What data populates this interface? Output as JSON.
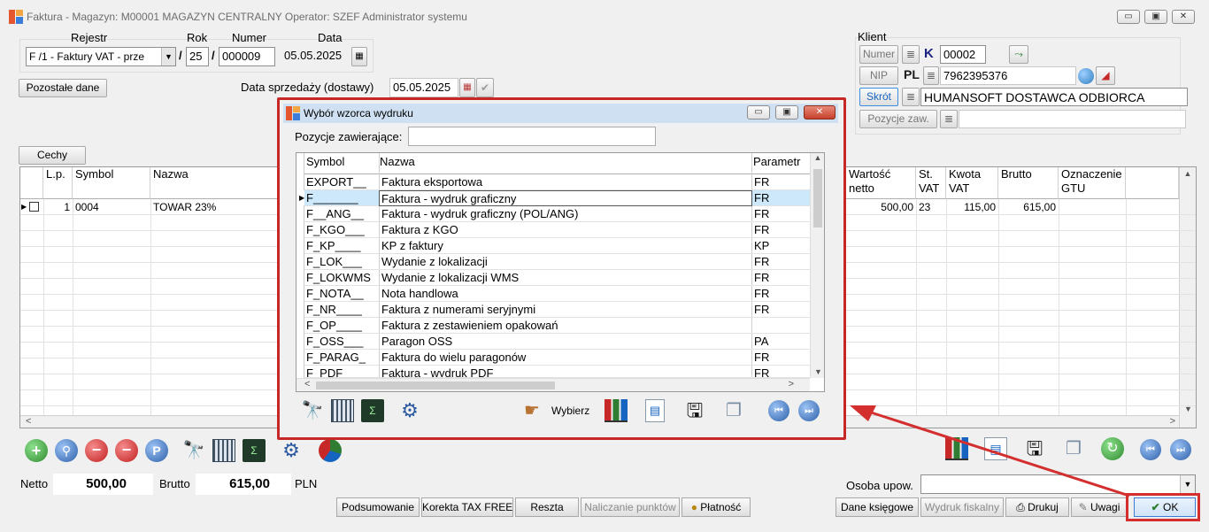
{
  "window": {
    "title": "Faktura - Magazyn: M00001 MAGAZYN CENTRALNY  Operator: SZEF Administrator systemu",
    "min_glyph": "▭",
    "max_glyph": "▣",
    "close_glyph": "✕"
  },
  "header": {
    "rejestr_label": "Rejestr",
    "rejestr_value": "F /1   - Faktury VAT - prze",
    "rok_label": "Rok",
    "rok_value": "25",
    "numer_label": "Numer",
    "numer_value": "000009",
    "data_label": "Data",
    "data_value": "05.05.2025",
    "slash": "/",
    "pozostale_button": "Pozostałe dane",
    "data_sprzedazy_label": "Data sprzedaży (dostawy)",
    "data_sprzedazy_value": "05.05.2025",
    "cechy_button": "Cechy"
  },
  "client": {
    "section_label": "Klient",
    "numer_button": "Numer",
    "k_badge": "K",
    "numer_value": "00002",
    "nip_button": "NIP",
    "pl_badge": "PL",
    "nip_value": "7962395376",
    "skrot_button": "Skrót",
    "skrot_value": "HUMANSOFT DOSTAWCA ODBIORCA",
    "pozycje_button": "Pozycje zaw.",
    "pozycje_value": ""
  },
  "grid": {
    "columns": [
      {
        "label": "L.p."
      },
      {
        "label": "Symbol"
      },
      {
        "label": "Nazwa"
      },
      {
        "label": "Wartość netto"
      },
      {
        "label": "St. VAT"
      },
      {
        "label": "Kwota VAT"
      },
      {
        "label": "Brutto"
      },
      {
        "label": "Oznaczenie GTU"
      }
    ],
    "rows": [
      {
        "lp": "1",
        "symbol": "0004",
        "nazwa": "TOWAR 23%",
        "netto": "500,00",
        "vat": "23",
        "kwota_vat": "115,00",
        "brutto": "615,00",
        "gtu": ""
      }
    ]
  },
  "dialog": {
    "title": "Wybór wzorca wydruku",
    "filter_label": "Pozycje zawierające:",
    "filter_value": "",
    "columns": {
      "symbol": "Symbol",
      "nazwa": "Nazwa",
      "param": "Parametr"
    },
    "rows": [
      {
        "symbol": "EXPORT__",
        "nazwa": "Faktura eksportowa",
        "param": "FR"
      },
      {
        "symbol": "F_______",
        "nazwa": "Faktura - wydruk graficzny",
        "param": "FR"
      },
      {
        "symbol": "F__ANG__",
        "nazwa": "Faktura - wydruk graficzny (POL/ANG)",
        "param": "FR"
      },
      {
        "symbol": "F_KGO___",
        "nazwa": "Faktura z KGO",
        "param": "FR"
      },
      {
        "symbol": "F_KP____",
        "nazwa": "KP z faktury",
        "param": "KP"
      },
      {
        "symbol": "F_LOK___",
        "nazwa": "Wydanie z lokalizacji",
        "param": "FR"
      },
      {
        "symbol": "F_LOKWMS",
        "nazwa": "Wydanie z lokalizacji WMS",
        "param": "FR"
      },
      {
        "symbol": "F_NOTA__",
        "nazwa": "Nota handlowa",
        "param": "FR"
      },
      {
        "symbol": "F_NR____",
        "nazwa": "Faktura z numerami seryjnymi",
        "param": "FR"
      },
      {
        "symbol": "F_OP____",
        "nazwa": "Faktura z zestawieniem opakowań",
        "param": ""
      },
      {
        "symbol": "F_OSS___",
        "nazwa": "Paragon OSS",
        "param": "PA"
      },
      {
        "symbol": "F_PARAG_",
        "nazwa": "Faktura do wielu paragonów",
        "param": "FR"
      },
      {
        "symbol": "F_PDF___",
        "nazwa": "Faktura - wydruk PDF",
        "param": "FR"
      }
    ],
    "wybierz_button": "Wybierz"
  },
  "totals": {
    "netto_label": "Netto",
    "netto_value": "500,00",
    "brutto_label": "Brutto",
    "brutto_value": "615,00",
    "currency": "PLN",
    "osoba_label": "Osoba upow."
  },
  "footer": {
    "podsumowanie": "Podsumowanie",
    "korekta": "Korekta TAX FREE",
    "reszta": "Reszta",
    "naliczanie": "Naliczanie punktów",
    "platnosc": "Płatność",
    "dane_ksiegowe": "Dane księgowe",
    "wydruk_fiskalny": "Wydruk fiskalny",
    "drukuj": "Drukuj",
    "uwagi": "Uwagi",
    "ok": "OK"
  },
  "colors": {
    "highlight": "#d32f2f",
    "selection": "#cde8fb",
    "title_active": "#cfe0f3"
  }
}
